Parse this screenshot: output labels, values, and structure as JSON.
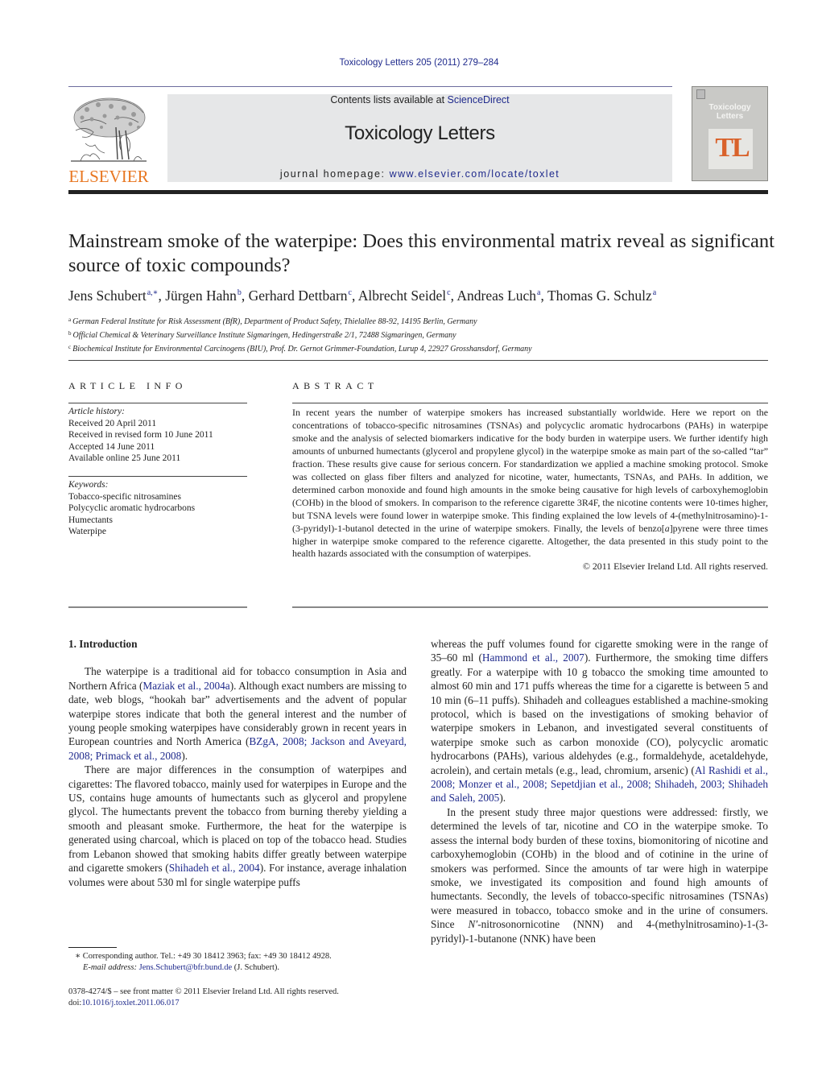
{
  "header": {
    "citation": "Toxicology Letters 205 (2011) 279–284",
    "contents_prefix": "Contents lists available at ",
    "contents_link": "ScienceDirect",
    "journal_title": "Toxicology Letters",
    "homepage_prefix": "journal homepage: ",
    "homepage_url": "www.elsevier.com/locate/toxlet",
    "publisher_logo_text": "ELSEVIER",
    "cover": {
      "title_line1": "Toxicology",
      "title_line2": "Letters",
      "monogram": "TL"
    },
    "colors": {
      "link": "#1f2a8c",
      "elsevier_orange": "#e87722",
      "cover_accent": "#d9622b",
      "header_box": "#e6e7e8"
    }
  },
  "article": {
    "title": "Mainstream smoke of the waterpipe: Does this environmental matrix reveal as significant source of toxic compounds?",
    "authors": [
      {
        "name": "Jens Schubert",
        "sup": "a,∗"
      },
      {
        "name": "Jürgen Hahn",
        "sup": "b"
      },
      {
        "name": "Gerhard Dettbarn",
        "sup": "c"
      },
      {
        "name": "Albrecht Seidel",
        "sup": "c"
      },
      {
        "name": "Andreas Luch",
        "sup": "a"
      },
      {
        "name": "Thomas G. Schulz",
        "sup": "a"
      }
    ],
    "affiliations": [
      {
        "key": "a",
        "text": "German Federal Institute for Risk Assessment (BfR), Department of Product Safety, Thielallee 88-92, 14195 Berlin, Germany"
      },
      {
        "key": "b",
        "text": "Official Chemical & Veterinary Surveillance Institute Sigmaringen, Hedingerstraße 2/1, 72488 Sigmaringen, Germany"
      },
      {
        "key": "c",
        "text": "Biochemical Institute for Environmental Carcinogens (BIU), Prof. Dr. Gernot Grimmer-Foundation, Lurup 4, 22927 Grosshansdorf, Germany"
      }
    ]
  },
  "article_info": {
    "heading": "ARTICLE INFO",
    "history_label": "Article history:",
    "history": [
      "Received 20 April 2011",
      "Received in revised form 10 June 2011",
      "Accepted 14 June 2011",
      "Available online 25 June 2011"
    ],
    "keywords_label": "Keywords:",
    "keywords": [
      "Tobacco-specific nitrosamines",
      "Polycyclic aromatic hydrocarbons",
      "Humectants",
      "Waterpipe"
    ]
  },
  "abstract": {
    "heading": "ABSTRACT",
    "text_1": "In recent years the number of waterpipe smokers has increased substantially worldwide. Here we report on the concentrations of tobacco-specific nitrosamines (TSNAs) and polycyclic aromatic hydrocarbons (PAHs) in waterpipe smoke and the analysis of selected biomarkers indicative for the body burden in waterpipe users. We further identify high amounts of unburned humectants (glycerol and propylene glycol) in the waterpipe smoke as main part of the so-called “tar” fraction. These results give cause for serious concern. For standardization we applied a machine smoking protocol. Smoke was collected on glass fiber filters and analyzed for nicotine, water, humectants, TSNAs, and PAHs. In addition, we determined carbon monoxide and found high amounts in the smoke being causative for high levels of carboxyhemoglobin (COHb) in the blood of smokers. In comparison to the reference cigarette 3R4F, the nicotine contents were 10-times higher, but TSNA levels were found lower in waterpipe smoke. This finding explained the low levels of 4-(methylnitrosamino)-1-(3-pyridyl)-1-butanol detected in the urine of waterpipe smokers. Finally, the levels of benzo[",
    "text_italic": "a",
    "text_2": "]pyrene were three times higher in waterpipe smoke compared to the reference cigarette. Altogether, the data presented in this study point to the health hazards associated with the consumption of waterpipes.",
    "copyright": "© 2011 Elsevier Ireland Ltd. All rights reserved."
  },
  "body": {
    "section_heading": "1.  Introduction",
    "left": {
      "p1_a": "The waterpipe is a traditional aid for tobacco consumption in Asia and Northern Africa (",
      "p1_ref1": "Maziak et al., 2004a",
      "p1_b": "). Although exact numbers are missing to date, web blogs, “hookah bar” advertisements and the advent of popular waterpipe stores indicate that both the general interest and the number of young people smoking waterpipes have considerably grown in recent years in European countries and North America (",
      "p1_ref2": "BZgA, 2008; Jackson and Aveyard, 2008; Primack et al., 2008",
      "p1_c": ").",
      "p2_a": "There are major differences in the consumption of waterpipes and cigarettes: The flavored tobacco, mainly used for waterpipes in Europe and the US, contains huge amounts of humectants such as glycerol and propylene glycol. The humectants prevent the tobacco from burning thereby yielding a smooth and pleasant smoke. Furthermore, the heat for the waterpipe is generated using charcoal, which is placed on top of the tobacco head. Studies from Lebanon showed that smoking habits differ greatly between waterpipe and cigarette smokers (",
      "p2_ref": "Shihadeh et al., 2004",
      "p2_b": "). For instance, average inhalation volumes were about 530 ml for single waterpipe puffs"
    },
    "right": {
      "p1_a": "whereas the puff volumes found for cigarette smoking were in the range of 35–60 ml (",
      "p1_ref1": "Hammond et al., 2007",
      "p1_b": "). Furthermore, the smoking time differs greatly. For a waterpipe with 10 g tobacco the smoking time amounted to almost 60 min and 171 puffs whereas the time for a cigarette is between 5 and 10 min (6–11 puffs). Shihadeh and colleagues established a machine-smoking protocol, which is based on the investigations of smoking behavior of waterpipe smokers in Lebanon, and investigated several constituents of waterpipe smoke such as carbon monoxide (CO), polycyclic aromatic hydrocarbons (PAHs), various aldehydes (e.g., formaldehyde, acetaldehyde, acrolein), and certain metals (e.g., lead, chromium, arsenic) (",
      "p1_ref2": "Al Rashidi et al., 2008; Monzer et al., 2008; Sepetdjian et al., 2008; Shihadeh, 2003; Shihadeh and Saleh, 2005",
      "p1_c": ").",
      "p2_a": "In the present study three major questions were addressed: firstly, we determined the levels of tar, nicotine and CO in the waterpipe smoke. To assess the internal body burden of these toxins, biomonitoring of nicotine and carboxyhemoglobin (COHb) in the blood and of cotinine in the urine of smokers was performed. Since the amounts of tar were high in waterpipe smoke, we investigated its composition and found high amounts of humectants. Secondly, the levels of tobacco-specific nitrosamines (TSNAs) were measured in tobacco, tobacco smoke and in the urine of consumers. Since ",
      "p2_italic": "N′",
      "p2_b": "-nitrosonornicotine (NNN) and 4-(methylnitrosamino)-1-(3-pyridyl)-1-butanone (NNK) have been"
    }
  },
  "footnotes": {
    "corresponding": "∗  Corresponding author. Tel.: +49 30 18412 3963; fax: +49 30 18412 4928.",
    "email_label": "E-mail address: ",
    "email": "Jens.Schubert@bfr.bund.de",
    "email_suffix": " (J. Schubert).",
    "issn": "0378-4274/$ – see front matter © 2011 Elsevier Ireland Ltd. All rights reserved.",
    "doi_prefix": "doi:",
    "doi": "10.1016/j.toxlet.2011.06.017"
  }
}
